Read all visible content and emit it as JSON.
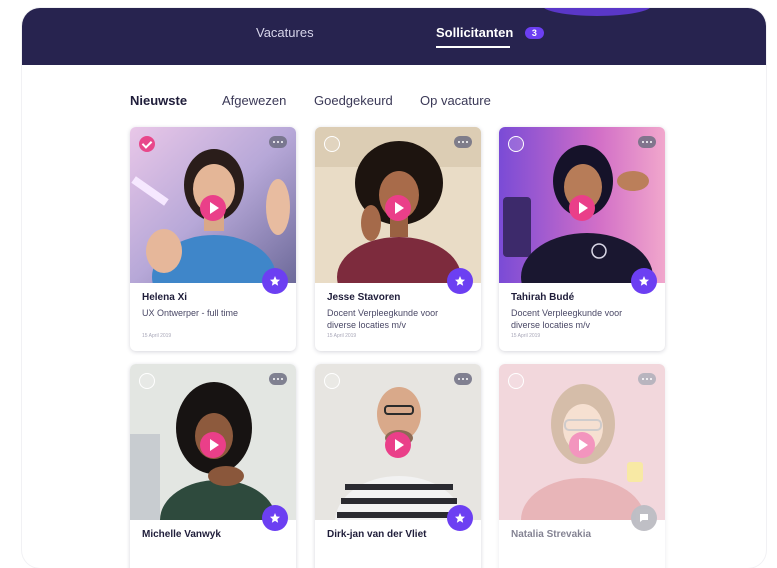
{
  "nav": {
    "tabs": [
      {
        "label": "Vacatures",
        "active": false
      },
      {
        "label": "Sollicitanten",
        "active": true,
        "badge": "3"
      }
    ]
  },
  "filters": [
    {
      "label": "Nieuwste",
      "active": true
    },
    {
      "label": "Afgewezen",
      "active": false
    },
    {
      "label": "Goedgekeurd",
      "active": false
    },
    {
      "label": "Op vacature",
      "active": false
    }
  ],
  "candidates": [
    {
      "name": "Helena Xi",
      "role": "UX Ontwerper - full time",
      "date": "15 April 2019",
      "selected": true,
      "starred": true
    },
    {
      "name": "Jesse Stavoren",
      "role": "Docent Verpleegkunde voor diverse locaties m/v",
      "date": "15 April 2019",
      "selected": false,
      "starred": true
    },
    {
      "name": "Tahirah Budé",
      "role": "Docent Verpleegkunde voor diverse locaties m/v",
      "date": "15 April 2019",
      "selected": false,
      "starred": true
    },
    {
      "name": "Michelle Vanwyk",
      "role": "",
      "date": "",
      "selected": false,
      "starred": true
    },
    {
      "name": "Dirk-jan van der Vliet",
      "role": "",
      "date": "",
      "selected": false,
      "starred": true
    },
    {
      "name": "Natalia Strevakia",
      "role": "",
      "date": "",
      "selected": false,
      "starred": false
    }
  ],
  "icons": {
    "select": "checkbox-circle-icon",
    "more": "more-dots-icon",
    "play": "play-icon",
    "star": "star-icon",
    "comment": "comment-icon"
  },
  "colors": {
    "header": "#27234f",
    "accent_purple": "#6c3ff2",
    "accent_pink": "#ea3f89"
  }
}
